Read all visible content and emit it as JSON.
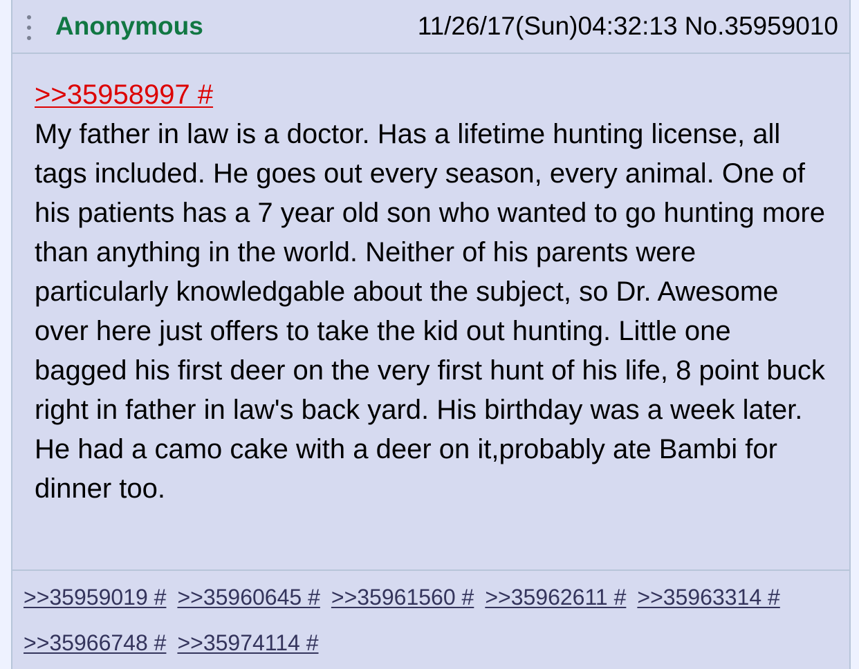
{
  "header": {
    "menu_icon": "vertical-ellipsis-icon",
    "name": "Anonymous",
    "datetime_and_number": "11/26/17(Sun)04:32:13 No.35959010"
  },
  "post": {
    "quote_link": ">>35958997 #",
    "message": "My father in law is a doctor. Has a lifetime hunting license, all tags included. He goes out every season, every animal. One of his patients has a 7 year old son who wanted to go hunting more than anything in the world. Neither of his parents were particularly knowledgable about the subject, so Dr. Awesome over here just offers to take the kid out hunting. Little one bagged his first deer on the very first hunt of his life, 8 point buck right in father in law's back yard. His birthday was a week later. He had a camo cake with a deer on it,probably ate Bambi for dinner too."
  },
  "replies": [
    ">>35959019 #",
    ">>35960645 #",
    ">>35961560 #",
    ">>35962611 #",
    ">>35963314 #",
    ">>35966748 #",
    ">>35974114 #"
  ],
  "colors": {
    "name": "#117743",
    "quote_link": "#dd0000",
    "reply_link": "#34345c",
    "post_background": "#d6daf0",
    "border": "#b7c5d9"
  }
}
